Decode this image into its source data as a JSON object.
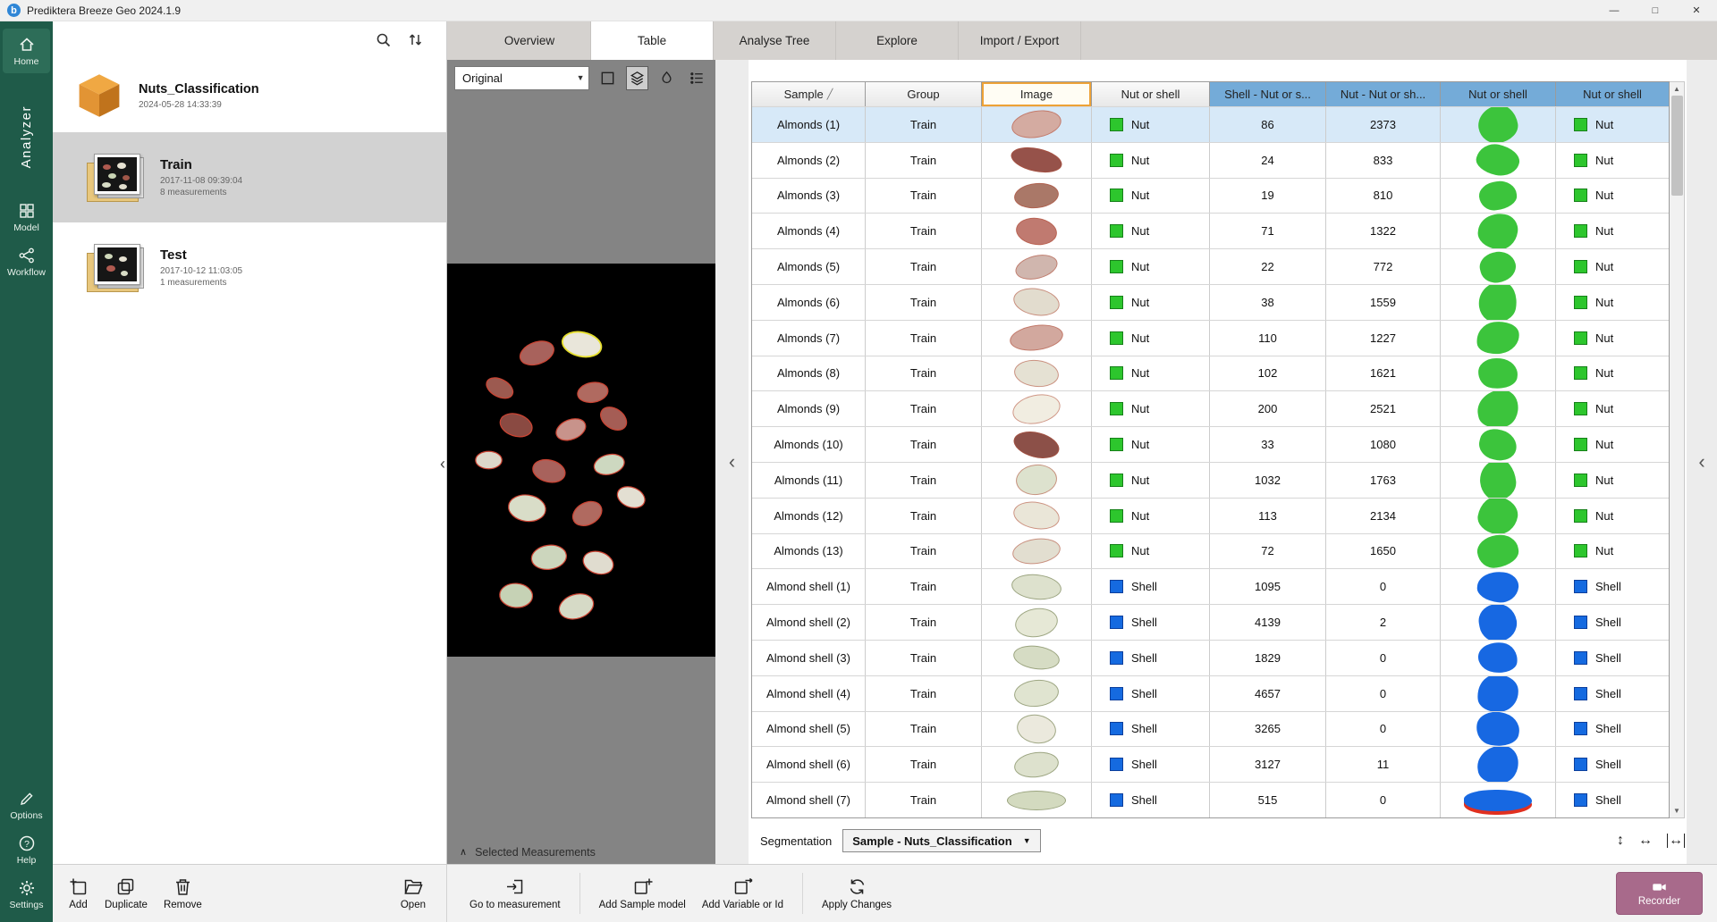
{
  "window": {
    "title": "Prediktera Breeze Geo 2024.1.9",
    "logo_letter": "b"
  },
  "icons": {
    "minimize": "—",
    "maximize": "□",
    "close": "✕",
    "chevron_left": "‹",
    "chevron_up": "∧",
    "dropdown": "▼",
    "sort_ascending": "╱",
    "scroll_up": "▲",
    "scroll_down": "▼",
    "resize_vertical": "↕",
    "resize_horizontal": "↔"
  },
  "colors": {
    "sidebar_green": "#1f5b49",
    "nut_green": "#2dc62d",
    "shell_blue": "#156ae0",
    "nut_blob_green": "#3cc43c",
    "shell_blob_blue": "#1768e2",
    "header_blue": "#74abd8",
    "selected_row_blue": "#d7e9f8",
    "image_column_highlight": "#eda237",
    "recorder_mauve": "#a86a8b"
  },
  "sidebar": {
    "home": "Home",
    "analyzer": "Analyzer",
    "model": "Model",
    "workflow": "Workflow",
    "options": "Options",
    "help": "Help",
    "settings": "Settings"
  },
  "project_panel": {
    "project_title": "Nuts_Classification",
    "project_timestamp": "2024-05-28 14:33:39",
    "measurements": [
      {
        "title": "Train",
        "timestamp": "2017-11-08 09:39:04",
        "count": "8 measurements",
        "selected": true
      },
      {
        "title": "Test",
        "timestamp": "2017-10-12 11:03:05",
        "count": "1 measurements",
        "selected": false
      }
    ]
  },
  "viewer": {
    "view_mode": "Original",
    "selected_measurements": "Selected Measurements"
  },
  "tabs": [
    {
      "label": "Overview",
      "active": false
    },
    {
      "label": "Table",
      "active": true
    },
    {
      "label": "Analyse Tree",
      "active": false
    },
    {
      "label": "Explore",
      "active": false
    },
    {
      "label": "Import / Export",
      "active": false
    }
  ],
  "table": {
    "columns": [
      {
        "label": "Sample",
        "sorted": true
      },
      {
        "label": "Group"
      },
      {
        "label": "Image",
        "highlighted": true
      },
      {
        "label": "Nut or shell"
      },
      {
        "label": "Shell - Nut or s...",
        "selected": true
      },
      {
        "label": "Nut - Nut or sh...",
        "selected": true
      },
      {
        "label": "Nut or shell",
        "selected": true
      },
      {
        "label": "Nut or shell",
        "selected": true
      }
    ],
    "rows": [
      {
        "sample": "Almonds (1)",
        "group": "Train",
        "class": "Nut",
        "shell_pixels": 86,
        "nut_pixels": 2373,
        "class2": "Nut",
        "selected": true
      },
      {
        "sample": "Almonds (2)",
        "group": "Train",
        "class": "Nut",
        "shell_pixels": 24,
        "nut_pixels": 833,
        "class2": "Nut"
      },
      {
        "sample": "Almonds (3)",
        "group": "Train",
        "class": "Nut",
        "shell_pixels": 19,
        "nut_pixels": 810,
        "class2": "Nut"
      },
      {
        "sample": "Almonds (4)",
        "group": "Train",
        "class": "Nut",
        "shell_pixels": 71,
        "nut_pixels": 1322,
        "class2": "Nut"
      },
      {
        "sample": "Almonds (5)",
        "group": "Train",
        "class": "Nut",
        "shell_pixels": 22,
        "nut_pixels": 772,
        "class2": "Nut"
      },
      {
        "sample": "Almonds (6)",
        "group": "Train",
        "class": "Nut",
        "shell_pixels": 38,
        "nut_pixels": 1559,
        "class2": "Nut"
      },
      {
        "sample": "Almonds (7)",
        "group": "Train",
        "class": "Nut",
        "shell_pixels": 110,
        "nut_pixels": 1227,
        "class2": "Nut"
      },
      {
        "sample": "Almonds (8)",
        "group": "Train",
        "class": "Nut",
        "shell_pixels": 102,
        "nut_pixels": 1621,
        "class2": "Nut"
      },
      {
        "sample": "Almonds (9)",
        "group": "Train",
        "class": "Nut",
        "shell_pixels": 200,
        "nut_pixels": 2521,
        "class2": "Nut"
      },
      {
        "sample": "Almonds (10)",
        "group": "Train",
        "class": "Nut",
        "shell_pixels": 33,
        "nut_pixels": 1080,
        "class2": "Nut"
      },
      {
        "sample": "Almonds (11)",
        "group": "Train",
        "class": "Nut",
        "shell_pixels": 1032,
        "nut_pixels": 1763,
        "class2": "Nut"
      },
      {
        "sample": "Almonds (12)",
        "group": "Train",
        "class": "Nut",
        "shell_pixels": 113,
        "nut_pixels": 2134,
        "class2": "Nut"
      },
      {
        "sample": "Almonds (13)",
        "group": "Train",
        "class": "Nut",
        "shell_pixels": 72,
        "nut_pixels": 1650,
        "class2": "Nut"
      },
      {
        "sample": "Almond shell (1)",
        "group": "Train",
        "class": "Shell",
        "shell_pixels": 1095,
        "nut_pixels": 0,
        "class2": "Shell"
      },
      {
        "sample": "Almond shell (2)",
        "group": "Train",
        "class": "Shell",
        "shell_pixels": 4139,
        "nut_pixels": 2,
        "class2": "Shell"
      },
      {
        "sample": "Almond shell (3)",
        "group": "Train",
        "class": "Shell",
        "shell_pixels": 1829,
        "nut_pixels": 0,
        "class2": "Shell"
      },
      {
        "sample": "Almond shell (4)",
        "group": "Train",
        "class": "Shell",
        "shell_pixels": 4657,
        "nut_pixels": 0,
        "class2": "Shell"
      },
      {
        "sample": "Almond shell (5)",
        "group": "Train",
        "class": "Shell",
        "shell_pixels": 3265,
        "nut_pixels": 0,
        "class2": "Shell"
      },
      {
        "sample": "Almond shell (6)",
        "group": "Train",
        "class": "Shell",
        "shell_pixels": 3127,
        "nut_pixels": 11,
        "class2": "Shell"
      },
      {
        "sample": "Almond shell (7)",
        "group": "Train",
        "class": "Shell",
        "shell_pixels": 515,
        "nut_pixels": 0,
        "class2": "Shell"
      }
    ]
  },
  "segmentation": {
    "label": "Segmentation",
    "value": "Sample - Nuts_Classification"
  },
  "toolbar": {
    "add": "Add",
    "duplicate": "Duplicate",
    "remove": "Remove",
    "open": "Open",
    "go_to_measurement": "Go to measurement",
    "add_sample_model": "Add Sample model",
    "add_variable_or_id": "Add Variable or Id",
    "apply_changes": "Apply Changes",
    "recorder": "Recorder"
  }
}
